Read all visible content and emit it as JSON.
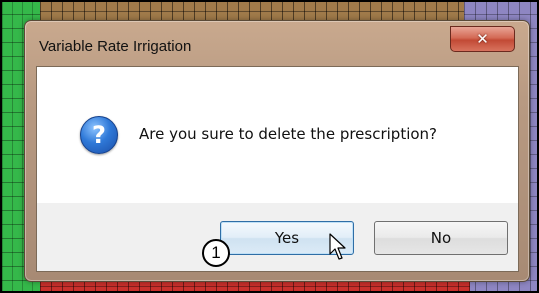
{
  "window": {
    "title": "Variable Rate Irrigation",
    "close_glyph": "✕"
  },
  "dialog": {
    "icon": "question-icon",
    "icon_glyph": "?",
    "message": "Are you sure to delete the prescription?"
  },
  "buttons": {
    "yes_label": "Yes",
    "no_label": "No"
  },
  "annotation": {
    "step_number": "1"
  },
  "colors": {
    "background_left": "#35b84a",
    "background_top": "#a07a4a",
    "background_right": "#8e86c2",
    "background_bottom": "#c9302c",
    "close_button": "#c24a35",
    "question_icon": "#2f79d8"
  }
}
